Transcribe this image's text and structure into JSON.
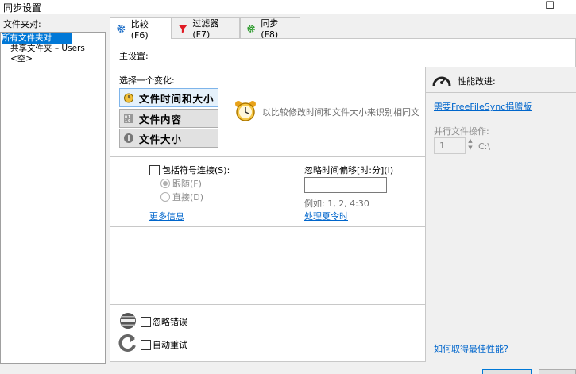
{
  "window": {
    "title": "同步设置",
    "minimize": "—",
    "maximize": "☐"
  },
  "left": {
    "label": "文件夹对:",
    "tree": [
      "所有文件夹对",
      "共享文件夹 – Users",
      "<空>"
    ]
  },
  "tabs": [
    {
      "label": "比较 (F6)",
      "icon": "gear-icon"
    },
    {
      "label": "过滤器 (F7)",
      "icon": "filter-icon"
    },
    {
      "label": "同步 (F8)",
      "icon": "sync-icon"
    }
  ],
  "main": {
    "section_label": "主设置:",
    "variant_label": "选择一个变化:",
    "variants": [
      "文件时间和大小",
      "文件内容",
      "文件大小"
    ],
    "variant_desc": "以比较修改时间和文件大小来识别相同文",
    "symlink": {
      "label": "包括符号连接(S):",
      "options": [
        "跟随(F)",
        "直接(D)"
      ],
      "more_info": "更多信息"
    },
    "time_shift": {
      "label": "忽略时间偏移[时:分](I)",
      "value": "",
      "example": "例如: 1, 2, 4:30",
      "dst_link": "处理夏令时"
    },
    "ignore_errors": "忽略错误",
    "auto_retry": "自动重试"
  },
  "perf": {
    "title": "性能改进:",
    "donation_link": "需要FreeFileSync捐赠版",
    "parallel_label": "并行文件操作:",
    "parallel_value": "1",
    "drive": "C:\\",
    "best_perf_link": "如何取得最佳性能?"
  },
  "colors": {
    "selection": "#0078d7",
    "link": "#0066cc",
    "accent_filter": "#e01b24",
    "accent_sync": "#2e9b2e"
  }
}
